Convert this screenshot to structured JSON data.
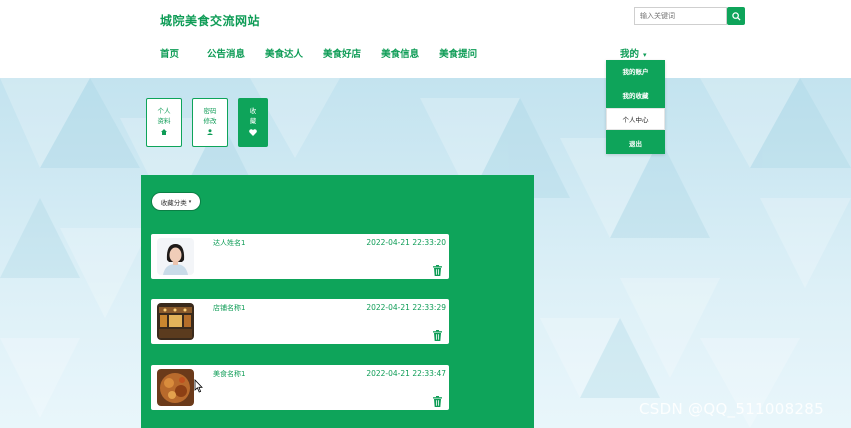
{
  "header": {
    "site_title": "城院美食交流网站",
    "search_placeholder": "输入关键词",
    "nav": [
      "首页",
      "公告消息",
      "美食达人",
      "美食好店",
      "美食信息",
      "美食提问"
    ],
    "mine_label": "我的",
    "dropdown": [
      "我的账户",
      "我的收藏",
      "个人中心",
      "退出"
    ]
  },
  "sidebar": [
    {
      "label": "个人\n资料",
      "icon": "home-icon"
    },
    {
      "label": "密码\n修改",
      "icon": "user-icon"
    },
    {
      "label": "收\n藏",
      "icon": "heart-icon"
    }
  ],
  "panel": {
    "filter_label": "收藏分类",
    "items": [
      {
        "name": "达人姓名1",
        "time": "2022-04-21 22:33:20",
        "thumb": "portrait"
      },
      {
        "name": "店铺名称1",
        "time": "2022-04-21 22:33:29",
        "thumb": "store"
      },
      {
        "name": "美食名称1",
        "time": "2022-04-21 22:33:47",
        "thumb": "food"
      }
    ]
  },
  "watermark": "CSDN @QQ_511008285",
  "colors": {
    "brand": "#0ea45a",
    "brand_text": "#0e9c56"
  }
}
